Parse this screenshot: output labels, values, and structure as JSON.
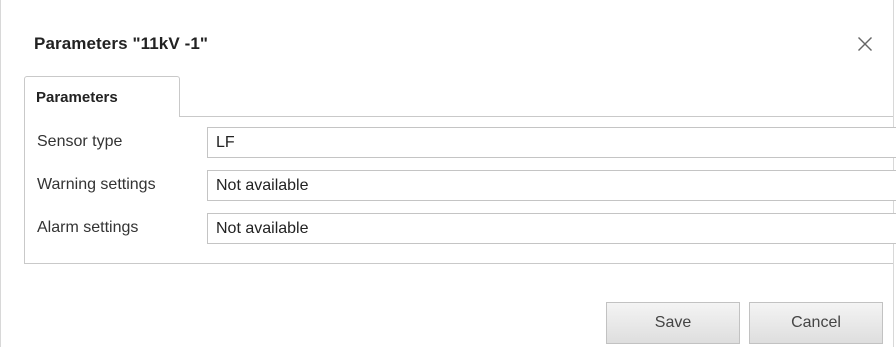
{
  "dialog": {
    "title": "Parameters \"11kV -1\"",
    "close_icon": "close-icon"
  },
  "tabs": [
    {
      "label": "Parameters",
      "active": true
    }
  ],
  "fields": [
    {
      "label": "Sensor type",
      "value": "LF"
    },
    {
      "label": "Warning settings",
      "value": "Not available"
    },
    {
      "label": "Alarm settings",
      "value": "Not available"
    }
  ],
  "buttons": {
    "save_label": "Save",
    "cancel_label": "Cancel"
  }
}
